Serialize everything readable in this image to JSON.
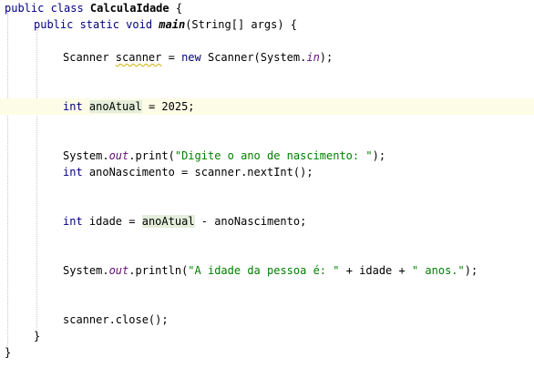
{
  "editor": {
    "language": "Java",
    "current_line_color": "#fdfce6",
    "occurrence_highlight_color": "#e4eedb",
    "keyword_color": "#000080",
    "string_color": "#008000",
    "static_field_color": "#660e7a",
    "lines": {
      "l1": [
        "public class ",
        "CalculaIdade",
        " {"
      ],
      "l2": [
        "public static void ",
        "main",
        "(String[] args) {"
      ],
      "l3": [
        "Scanner ",
        "scanner",
        " = ",
        "new",
        " Scanner(System.",
        "in",
        ");"
      ],
      "l4": [
        "int",
        " ",
        "anoAtual",
        " = 2025;"
      ],
      "l5": [
        "System.",
        "out",
        ".print(",
        "\"Digite o ano de nascimento: \"",
        ");"
      ],
      "l6": [
        "int",
        " anoNascimento = scanner.nextInt();"
      ],
      "l7": [
        "int",
        " idade = ",
        "anoAtual",
        " - anoNascimento;"
      ],
      "l8": [
        "System.",
        "out",
        ".println(",
        "\"A idade da pessoa é: \"",
        " + idade + ",
        "\" anos.\"",
        ");"
      ],
      "l9": [
        "scanner.close();"
      ],
      "l10": [
        "}"
      ],
      "l11": [
        "}"
      ]
    }
  }
}
